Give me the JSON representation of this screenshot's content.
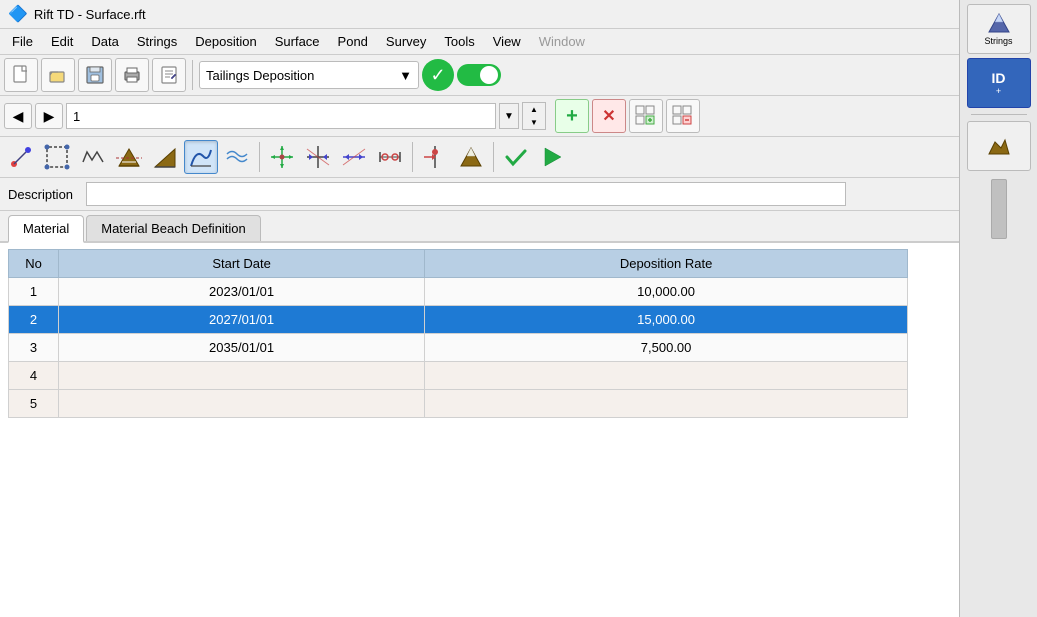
{
  "window": {
    "title": "Rift TD - Surface.rft",
    "icon": "🔷"
  },
  "menu": {
    "items": [
      "File",
      "Edit",
      "Data",
      "Strings",
      "Deposition",
      "Surface",
      "Pond",
      "Survey",
      "Tools",
      "View",
      "Window"
    ]
  },
  "toolbar1": {
    "buttons": [
      {
        "name": "new",
        "icon": "📄"
      },
      {
        "name": "open",
        "icon": "📂"
      },
      {
        "name": "save",
        "icon": "💾"
      },
      {
        "name": "print",
        "icon": "🖨"
      },
      {
        "name": "edit",
        "icon": "📝"
      }
    ],
    "dropdown_value": "Tailings Deposition",
    "dropdown_arrow": "▼"
  },
  "toolbar2": {
    "nav_back": "◀",
    "nav_forward": "▶",
    "nav_value": "1",
    "spin_up": "▲",
    "spin_down": "▼",
    "add": "+",
    "delete": "✕",
    "grid_add": "⊞",
    "grid_del": "⊟"
  },
  "toolbar3": {
    "buttons": [
      {
        "name": "point-tool",
        "icon": "⬤",
        "active": false
      },
      {
        "name": "select-tool",
        "icon": "⬛",
        "active": false
      },
      {
        "name": "wave-tool",
        "icon": "〰",
        "active": false
      },
      {
        "name": "level-tool",
        "icon": "⏧",
        "active": false
      },
      {
        "name": "slope-tool",
        "icon": "◢",
        "active": false
      },
      {
        "name": "curve-tool",
        "icon": "📈",
        "active": true
      },
      {
        "name": "ripple-tool",
        "icon": "≋",
        "active": false
      },
      {
        "name": "move-all",
        "icon": "✛",
        "active": false
      },
      {
        "name": "compress",
        "icon": "⤢",
        "active": false
      },
      {
        "name": "spread",
        "icon": "⤡",
        "active": false
      },
      {
        "name": "distribute",
        "icon": "⟺",
        "active": false
      },
      {
        "name": "split-tool",
        "icon": "⊣",
        "active": false
      },
      {
        "name": "mountain",
        "icon": "⛰",
        "active": false
      },
      {
        "name": "check-green",
        "icon": "✓",
        "active": false
      },
      {
        "name": "play",
        "icon": "▶",
        "active": false
      }
    ]
  },
  "description": {
    "label": "Description",
    "value": "",
    "placeholder": ""
  },
  "tabs": [
    {
      "id": "material",
      "label": "Material",
      "active": true
    },
    {
      "id": "material-beach",
      "label": "Material Beach Definition",
      "active": false
    }
  ],
  "table": {
    "headers": [
      "No",
      "Start Date",
      "Deposition Rate"
    ],
    "rows": [
      {
        "no": "1",
        "start_date": "2023/01/01",
        "deposition_rate": "10,000.00",
        "selected": false
      },
      {
        "no": "2",
        "start_date": "2027/01/01",
        "deposition_rate": "15,000.00",
        "selected": true
      },
      {
        "no": "3",
        "start_date": "2035/01/01",
        "deposition_rate": "7,500.00",
        "selected": false
      },
      {
        "no": "4",
        "start_date": "",
        "deposition_rate": "",
        "selected": false,
        "empty": true
      },
      {
        "no": "5",
        "start_date": "",
        "deposition_rate": "",
        "selected": false,
        "empty": true
      }
    ]
  },
  "right_panel": {
    "buttons": [
      {
        "name": "strings-panel",
        "icon": "⬡",
        "label": "Strings",
        "active": false
      },
      {
        "name": "id-panel",
        "icon": "ID",
        "label": "ID",
        "active": true
      },
      {
        "name": "terrain-panel",
        "icon": "🏔",
        "label": "Terrain",
        "active": false
      }
    ]
  },
  "colors": {
    "accent_blue": "#1e7ad4",
    "header_blue": "#b8cfe4",
    "green": "#22bb44",
    "toolbar_bg": "#f0f0f0",
    "selected_row": "#1e7ad4",
    "empty_row": "#f5f0ec"
  }
}
